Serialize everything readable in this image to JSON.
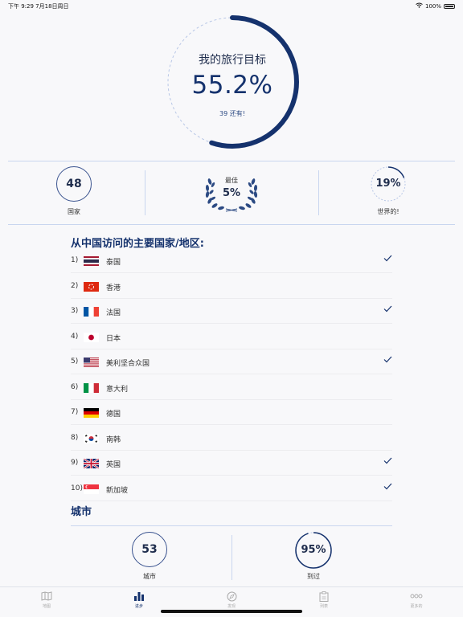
{
  "status_bar": {
    "time_date": "下午 9:29   7月18日周日",
    "battery": "100%"
  },
  "goal": {
    "title": "我的旅行目标",
    "percent": "55.2%",
    "progress": 0.552,
    "subtitle": "39 还有!"
  },
  "stats": {
    "countries": {
      "value": "48",
      "label": "国家"
    },
    "best": {
      "label": "最佳",
      "value": "5%"
    },
    "world": {
      "value": "19%",
      "label": "世界的!",
      "progress": 0.19
    }
  },
  "countries_section": {
    "title": "从中国访问的主要国家/地区:",
    "items": [
      {
        "rank": "1)",
        "flag": "thailand",
        "name": "泰国",
        "visited": true
      },
      {
        "rank": "2)",
        "flag": "hong-kong",
        "name": "香港",
        "visited": false
      },
      {
        "rank": "3)",
        "flag": "france",
        "name": "法国",
        "visited": true
      },
      {
        "rank": "4)",
        "flag": "japan",
        "name": "日本",
        "visited": false
      },
      {
        "rank": "5)",
        "flag": "usa",
        "name": "美利坚合众国",
        "visited": true
      },
      {
        "rank": "6)",
        "flag": "italy",
        "name": "意大利",
        "visited": false
      },
      {
        "rank": "7)",
        "flag": "germany",
        "name": "德国",
        "visited": false
      },
      {
        "rank": "8)",
        "flag": "south-korea",
        "name": "南韩",
        "visited": false
      },
      {
        "rank": "9)",
        "flag": "uk",
        "name": "英国",
        "visited": true
      },
      {
        "rank": "10)",
        "flag": "singapore",
        "name": "新加坡",
        "visited": true
      }
    ]
  },
  "cities_section": {
    "title": "城市",
    "cities": {
      "value": "53",
      "label": "城市"
    },
    "visited": {
      "value": "95%",
      "label": "到过",
      "progress": 0.95
    }
  },
  "tabbar": {
    "tabs": [
      {
        "icon": "map-icon",
        "label": "地图",
        "active": false
      },
      {
        "icon": "bar-chart-icon",
        "label": "进步",
        "active": true
      },
      {
        "icon": "compass-icon",
        "label": "发现",
        "active": false
      },
      {
        "icon": "clipboard-icon",
        "label": "列表",
        "active": false
      },
      {
        "icon": "more-icon",
        "label": "更多的",
        "active": false
      }
    ]
  },
  "colors": {
    "accent": "#15326d",
    "divider": "#c9d6ef",
    "background": "#f8f8fa"
  }
}
